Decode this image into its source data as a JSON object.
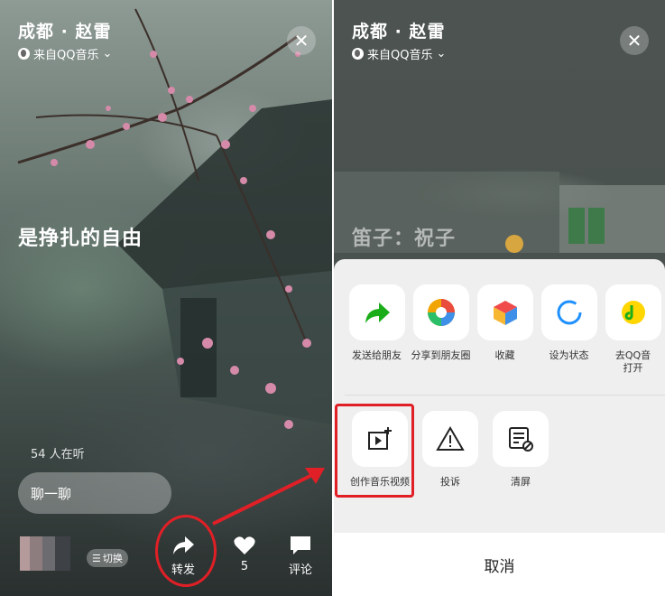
{
  "left": {
    "song_title": "成都 · 赵雷",
    "source_label": "来自QQ音乐",
    "chevron": "⌄",
    "close_glyph": "✕",
    "lyric": "是挣扎的自由",
    "listeners": "54 人在听",
    "chat_placeholder": "聊一聊",
    "switch_label": "切换",
    "actions": {
      "forward": "转发",
      "like_count": "5",
      "comment": "评论"
    }
  },
  "right": {
    "song_title": "成都 · 赵雷",
    "source_label": "来自QQ音乐",
    "chevron": "⌄",
    "close_glyph": "✕",
    "lyric": "笛子：祝子",
    "share_row": [
      {
        "label": "发送给朋友",
        "icon": "forward-arrow-icon",
        "color": "#1aad19"
      },
      {
        "label": "分享到朋友圈",
        "icon": "moments-icon",
        "color": "#f2a400"
      },
      {
        "label": "收藏",
        "icon": "favorite-cube-icon",
        "color": "#f04a4a"
      },
      {
        "label": "设为状态",
        "icon": "status-ring-icon",
        "color": "#1e90ff"
      },
      {
        "label": "去QQ音\n打开",
        "icon": "qq-music-icon",
        "color": "#ffd600"
      }
    ],
    "action_row": [
      {
        "label": "创作音乐视频",
        "icon": "create-video-icon"
      },
      {
        "label": "投诉",
        "icon": "warning-icon"
      },
      {
        "label": "清屏",
        "icon": "clear-screen-icon"
      }
    ],
    "cancel_label": "取消"
  },
  "colors": {
    "highlight": "#e11f26",
    "sheet_bg": "#efefef"
  }
}
